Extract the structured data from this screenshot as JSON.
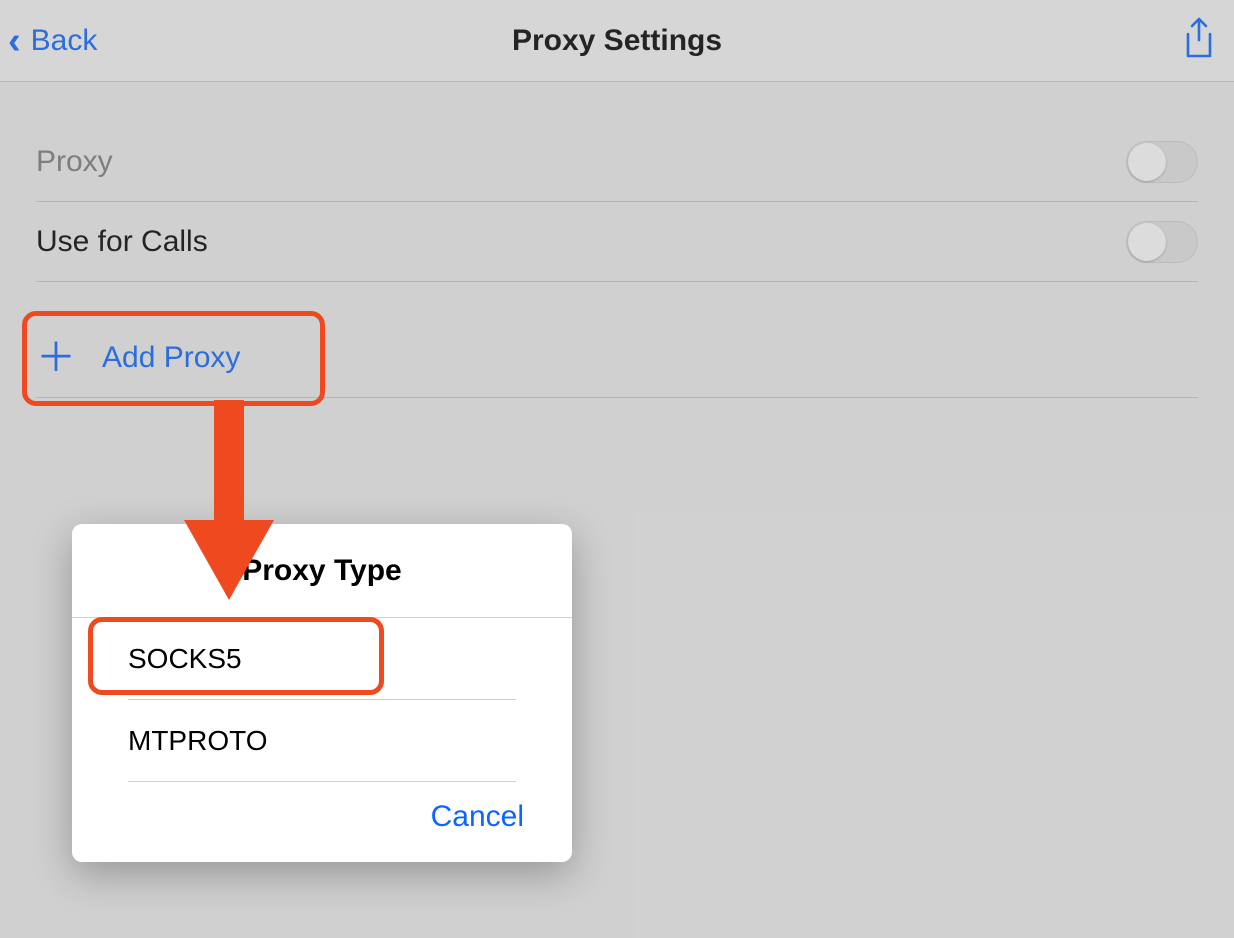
{
  "navbar": {
    "back_label": "Back",
    "title": "Proxy Settings"
  },
  "rows": {
    "proxy_label": "Proxy",
    "calls_label": "Use for Calls",
    "add_label": "Add Proxy"
  },
  "dialog": {
    "title": "Proxy Type",
    "items": [
      "SOCKS5",
      "MTPROTO"
    ],
    "cancel_label": "Cancel"
  },
  "colors": {
    "accent": "#0a66ff",
    "highlight": "#ef4a1f"
  }
}
